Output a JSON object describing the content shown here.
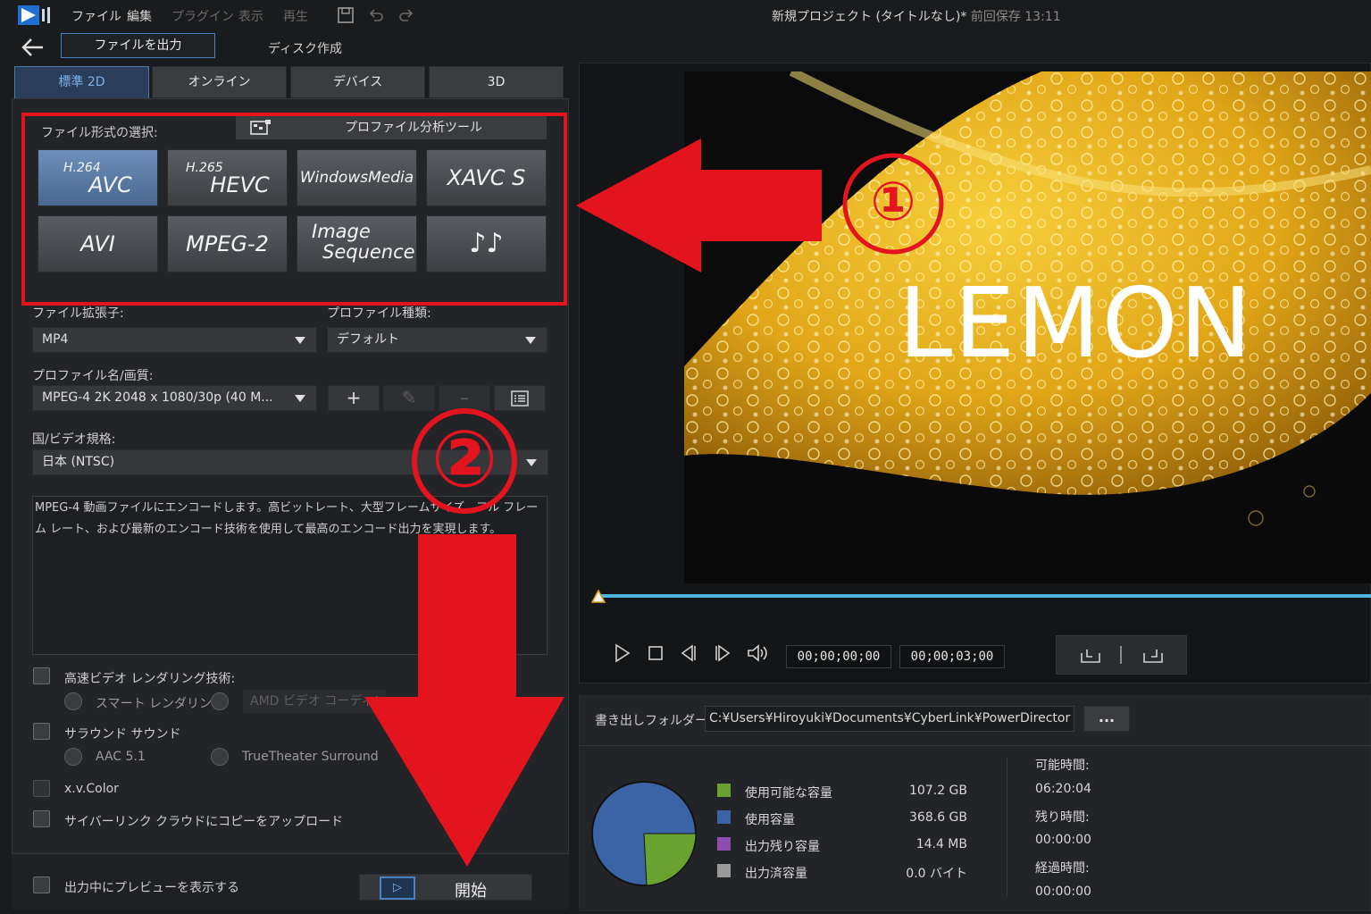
{
  "menubar": {
    "items": [
      "ファイル",
      "編集",
      "プラグイン",
      "表示",
      "再生"
    ],
    "title": "新規プロジェクト (タイトルなし)*",
    "last_saved": "前回保存 13:11"
  },
  "mode": {
    "active": "ファイルを出力",
    "other": "ディスク作成"
  },
  "tabs": [
    "標準 2D",
    "オンライン",
    "デバイス",
    "3D"
  ],
  "format_section": {
    "label": "ファイル形式の選択:",
    "profile_tool": "プロファイル分析ツール",
    "formats": [
      {
        "sup": "H.264",
        "main": "AVC"
      },
      {
        "sup": "H.265",
        "main": "HEVC"
      },
      {
        "main": "WindowsMedia"
      },
      {
        "main": "XAVC S"
      },
      {
        "main": "AVI"
      },
      {
        "main": "MPEG-2"
      },
      {
        "line1": "Image",
        "line2": "Sequence"
      },
      {
        "main": "♪♪"
      }
    ]
  },
  "fields": {
    "ext_label": "ファイル拡張子:",
    "ext_value": "MP4",
    "profile_type_label": "プロファイル種類:",
    "profile_type_value": "デフォルト",
    "profile_name_label": "プロファイル名/画質:",
    "profile_name_value": "MPEG-4 2K 2048 x 1080/30p (40 M...",
    "country_label": "国/ビデオ規格:",
    "country_value": "日本 (NTSC)",
    "description": "MPEG-4 動画ファイルにエンコードします。高ビットレート、大型フレームサイズ、フル フレーム レート、および最新のエンコード技術を使用して最高のエンコード出力を実現します。"
  },
  "options": {
    "fast_render": "高速ビデオ レンダリング技術:",
    "smart_render": "スマート レンダリン...",
    "amd_coding": "AMD ビデオ コーディング",
    "surround": "サラウンド サウンド",
    "aac": "AAC 5.1",
    "truetheater": "TrueTheater Surround",
    "xvcolor": "x.v.Color",
    "cloud_upload": "サイバーリンク クラウドにコピーをアップロード",
    "preview_during": "出力中にプレビューを表示する",
    "start": "開始"
  },
  "preview": {
    "overlay_text": "LEMON",
    "timecode_current": "00;00;00;00",
    "timecode_total": "00;00;03;00"
  },
  "output": {
    "folder_label": "書き出しフォルダー:",
    "folder_path": "C:¥Users¥Hiroyuki¥Documents¥CyberLink¥PowerDirector",
    "browse": "...",
    "legend": [
      {
        "label": "使用可能な容量",
        "value": "107.2  GB",
        "color": "#6aa232"
      },
      {
        "label": "使用容量",
        "value": "368.6  GB",
        "color": "#3a64a6"
      },
      {
        "label": "出力残り容量",
        "value": "14.4  MB",
        "color": "#8e4cb0"
      },
      {
        "label": "出力済容量",
        "value": "0.0  バイト",
        "color": "#9a9a9a"
      }
    ],
    "times": [
      {
        "label": "可能時間:",
        "value": "06:20:04"
      },
      {
        "label": "残り時間:",
        "value": "00:00:00"
      },
      {
        "label": "経過時間:",
        "value": "00:00:00"
      }
    ]
  },
  "annotations": {
    "marker1": "①",
    "marker2": "②"
  },
  "colors": {
    "accent": "#4c82c4",
    "annotation_red": "#e3141e"
  }
}
